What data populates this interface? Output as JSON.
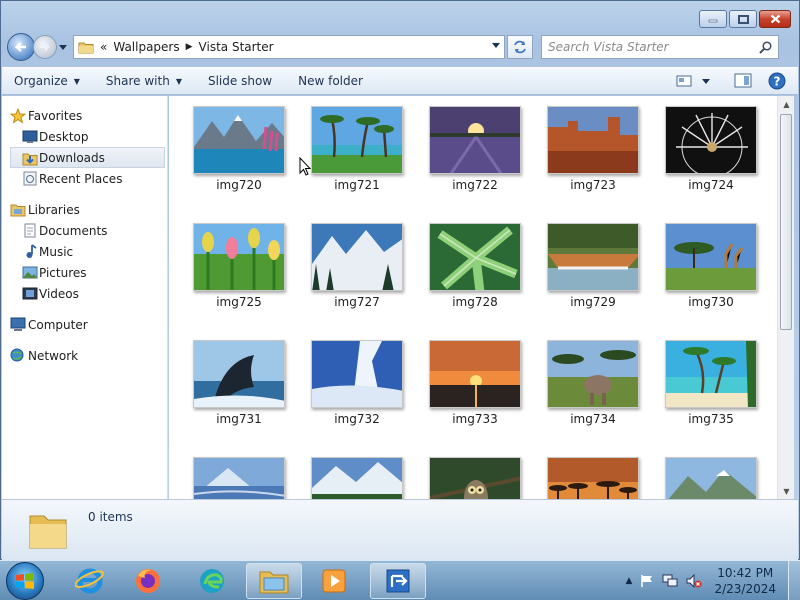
{
  "window": {
    "caption_buttons": [
      "minimize-icon",
      "maximize-icon",
      "close-icon"
    ]
  },
  "address": {
    "chevron": "«",
    "crumbs": [
      "Wallpapers",
      "Vista Starter"
    ]
  },
  "search": {
    "placeholder": "Search Vista Starter"
  },
  "toolbar": {
    "organize": "Organize",
    "share_with": "Share with",
    "slide_show": "Slide show",
    "new_folder": "New folder"
  },
  "sidebar": {
    "favorites": {
      "label": "Favorites",
      "items": [
        "Desktop",
        "Downloads",
        "Recent Places"
      ]
    },
    "libraries": {
      "label": "Libraries",
      "items": [
        "Documents",
        "Music",
        "Pictures",
        "Videos"
      ]
    },
    "computer": "Computer",
    "network": "Network"
  },
  "files": [
    {
      "name": "img720",
      "theme": "lake-mountains"
    },
    {
      "name": "img721",
      "theme": "palm-beach"
    },
    {
      "name": "img722",
      "theme": "sunset-field"
    },
    {
      "name": "img723",
      "theme": "red-canyon"
    },
    {
      "name": "img724",
      "theme": "dandelion"
    },
    {
      "name": "img725",
      "theme": "tulips"
    },
    {
      "name": "img727",
      "theme": "snow-mountains"
    },
    {
      "name": "img728",
      "theme": "green-leaves"
    },
    {
      "name": "img729",
      "theme": "waterfall"
    },
    {
      "name": "img730",
      "theme": "giraffes"
    },
    {
      "name": "img731",
      "theme": "whale"
    },
    {
      "name": "img732",
      "theme": "glacier"
    },
    {
      "name": "img733",
      "theme": "orange-sunset"
    },
    {
      "name": "img734",
      "theme": "elephant"
    },
    {
      "name": "img735",
      "theme": "tropical-beach"
    },
    {
      "name": "",
      "theme": "fuji"
    },
    {
      "name": "",
      "theme": "alpine-lake"
    },
    {
      "name": "",
      "theme": "owl"
    },
    {
      "name": "",
      "theme": "savanna-sunset"
    },
    {
      "name": "",
      "theme": "valley"
    }
  ],
  "details": {
    "count": "0 items"
  },
  "taskbar": {
    "apps": [
      "internet-explorer-icon",
      "firefox-icon",
      "edge-icon",
      "windows-explorer-icon",
      "media-player-icon",
      "remote-app-icon"
    ],
    "time": "10:42 PM",
    "date": "2/23/2024"
  },
  "colors": {
    "accent": "#2a7cc2",
    "selection": "#dfe6ef",
    "close": "#c8432e"
  }
}
